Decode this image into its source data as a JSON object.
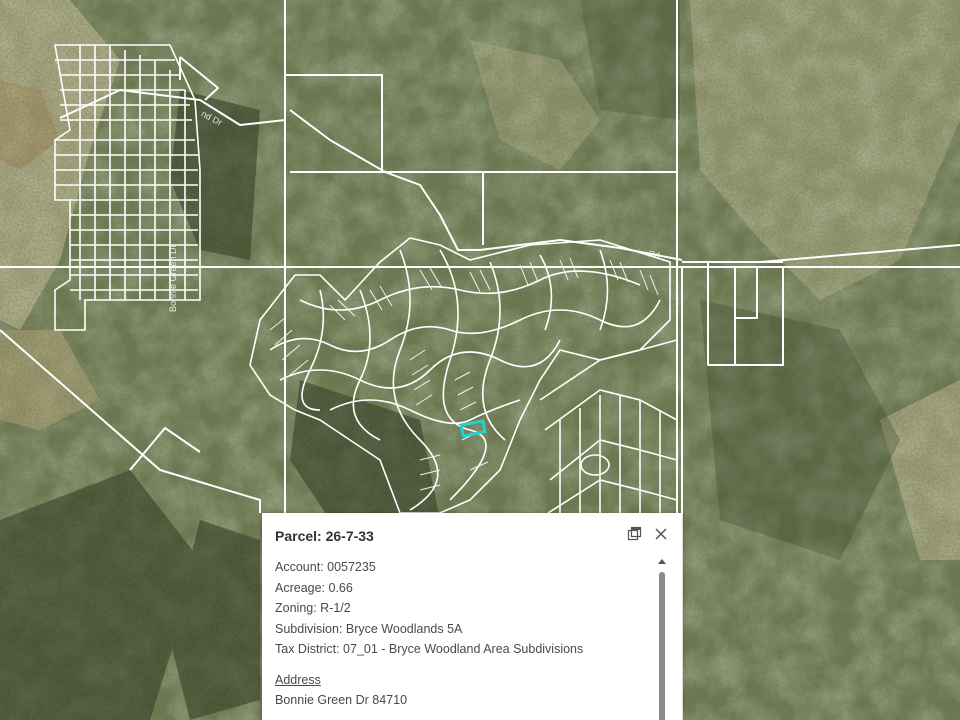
{
  "map": {
    "road_labels": [
      "Bonnie Green Dr",
      "Rd",
      "nd Dr"
    ],
    "selected_parcel_color": "#26d0d0",
    "line_color": "#ffffff"
  },
  "popup": {
    "title": "Parcel: 26-7-33",
    "fields": [
      {
        "label": "Account",
        "value": "0057235",
        "text": "Account: 0057235"
      },
      {
        "label": "Acreage",
        "value": "0.66",
        "text": "Acreage: 0.66"
      },
      {
        "label": "Zoning",
        "value": "R-1/2",
        "text": "Zoning: R-1/2"
      },
      {
        "label": "Subdivision",
        "value": "Bryce Woodlands 5A",
        "text": "Subdivision: Bryce Woodlands 5A"
      },
      {
        "label": "Tax District",
        "value": "07_01 - Bryce Woodland Area Subdivisions",
        "text": "Tax District: 07_01 - Bryce Woodland Area Subdivisions"
      }
    ],
    "address_heading": "Address",
    "address_value": "Bonnie Green Dr 84710",
    "dock_icon": "dock-icon",
    "close_icon": "close-icon"
  }
}
